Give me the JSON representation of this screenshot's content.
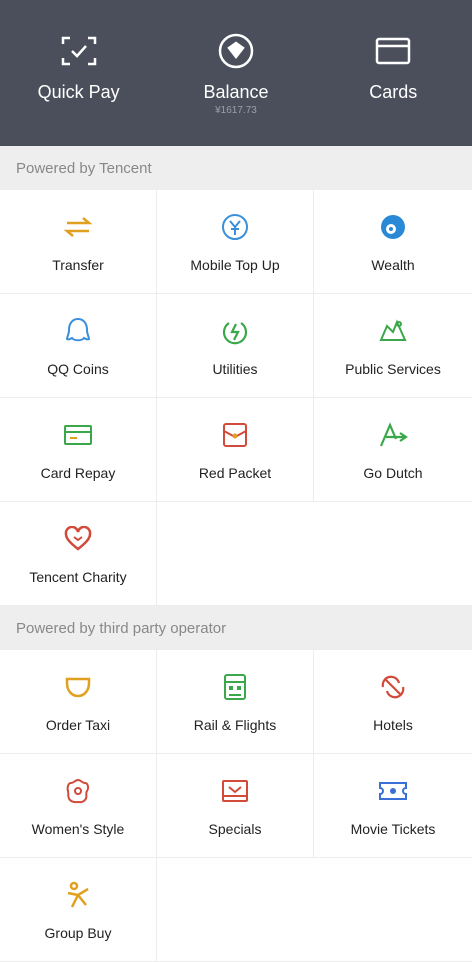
{
  "header": {
    "items": [
      {
        "label": "Quick Pay",
        "icon": "scan-check-icon"
      },
      {
        "label": "Balance",
        "sub": "¥1617.73",
        "icon": "balance-icon"
      },
      {
        "label": "Cards",
        "icon": "card-icon"
      }
    ]
  },
  "sections": [
    {
      "title": "Powered by Tencent",
      "items": [
        {
          "label": "Transfer",
          "icon": "transfer-icon",
          "color": "#e0a020"
        },
        {
          "label": "Mobile Top Up",
          "icon": "mobile-top-up-icon",
          "color": "#3a8fd8"
        },
        {
          "label": "Wealth",
          "icon": "wealth-icon",
          "color": "#2a89d6"
        },
        {
          "label": "QQ Coins",
          "icon": "qq-coins-icon",
          "color": "#3a8fd8"
        },
        {
          "label": "Utilities",
          "icon": "utilities-icon",
          "color": "#3aa84a"
        },
        {
          "label": "Public Services",
          "icon": "public-services-icon",
          "color": "#3aa84a"
        },
        {
          "label": "Card Repay",
          "icon": "card-repay-icon",
          "color": "#3aa84a"
        },
        {
          "label": "Red Packet",
          "icon": "red-packet-icon",
          "color": "#d24a3a"
        },
        {
          "label": "Go Dutch",
          "icon": "go-dutch-icon",
          "color": "#3aa84a"
        },
        {
          "label": "Tencent Charity",
          "icon": "charity-heart-icon",
          "color": "#d24a3a"
        }
      ]
    },
    {
      "title": "Powered by third party operator",
      "items": [
        {
          "label": "Order Taxi",
          "icon": "taxi-icon",
          "color": "#e0a020"
        },
        {
          "label": "Rail & Flights",
          "icon": "rail-flights-icon",
          "color": "#3aa84a"
        },
        {
          "label": "Hotels",
          "icon": "hotels-icon",
          "color": "#d24a3a"
        },
        {
          "label": "Women's Style",
          "icon": "womens-style-icon",
          "color": "#d24a3a"
        },
        {
          "label": "Specials",
          "icon": "specials-icon",
          "color": "#d24a3a"
        },
        {
          "label": "Movie Tickets",
          "icon": "movie-tickets-icon",
          "color": "#3a6fd8"
        },
        {
          "label": "Group Buy",
          "icon": "group-buy-icon",
          "color": "#e0a020"
        }
      ]
    }
  ]
}
